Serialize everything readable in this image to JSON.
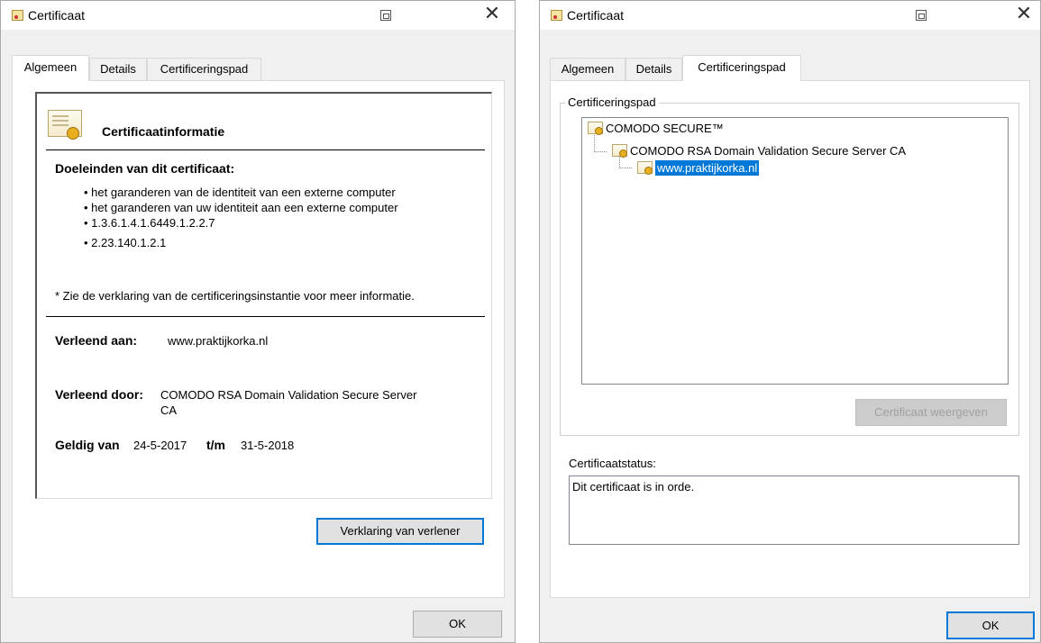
{
  "window_general": {
    "title": "Certificaat",
    "tabs": [
      {
        "label": "Algemeen",
        "active": true
      },
      {
        "label": "Details",
        "active": false
      },
      {
        "label": "Certificeringspad",
        "active": false
      }
    ],
    "info_heading": "Certificaatinformatie",
    "purposes_heading": "Doeleinden van dit certificaat:",
    "purposes": [
      "het garanderen van de identiteit van een externe computer",
      "het garanderen van uw identiteit aan een externe computer",
      "1.3.6.1.4.1.6449.1.2.2.7",
      "2.23.140.1.2.1"
    ],
    "note": "* Zie de verklaring van de certificeringsinstantie voor meer informatie.",
    "issued_to_label": "Verleend aan:",
    "issued_to_value": "www.praktijkorka.nl",
    "issued_by_label": "Verleend door:",
    "issued_by_value_line1": "COMODO RSA Domain Validation Secure Server",
    "issued_by_value_line2": "CA",
    "valid_from_label": "Geldig van",
    "valid_from_value": "24-5-2017",
    "valid_to_label": "t/m",
    "valid_to_value": "31-5-2018",
    "issuer_statement_button": "Verklaring van verlener",
    "ok_button": "OK"
  },
  "window_path": {
    "title": "Certificaat",
    "tabs": [
      {
        "label": "Algemeen",
        "active": false
      },
      {
        "label": "Details",
        "active": false
      },
      {
        "label": "Certificeringspad",
        "active": true
      }
    ],
    "path_group_label": "Certificeringspad",
    "tree": [
      {
        "label": "COMODO SECURE™",
        "level": 0,
        "selected": false
      },
      {
        "label": "COMODO RSA Domain Validation Secure Server CA",
        "level": 1,
        "selected": false
      },
      {
        "label": "www.praktijkorka.nl",
        "level": 2,
        "selected": true
      }
    ],
    "view_cert_button": "Certificaat weergeven",
    "status_label": "Certificaatstatus:",
    "status_value": "Dit certificaat is in orde.",
    "ok_button": "OK"
  },
  "colors": {
    "selection": "#0078d7",
    "focus_border": "#0078d7",
    "window_bg": "#f0f0f0"
  }
}
